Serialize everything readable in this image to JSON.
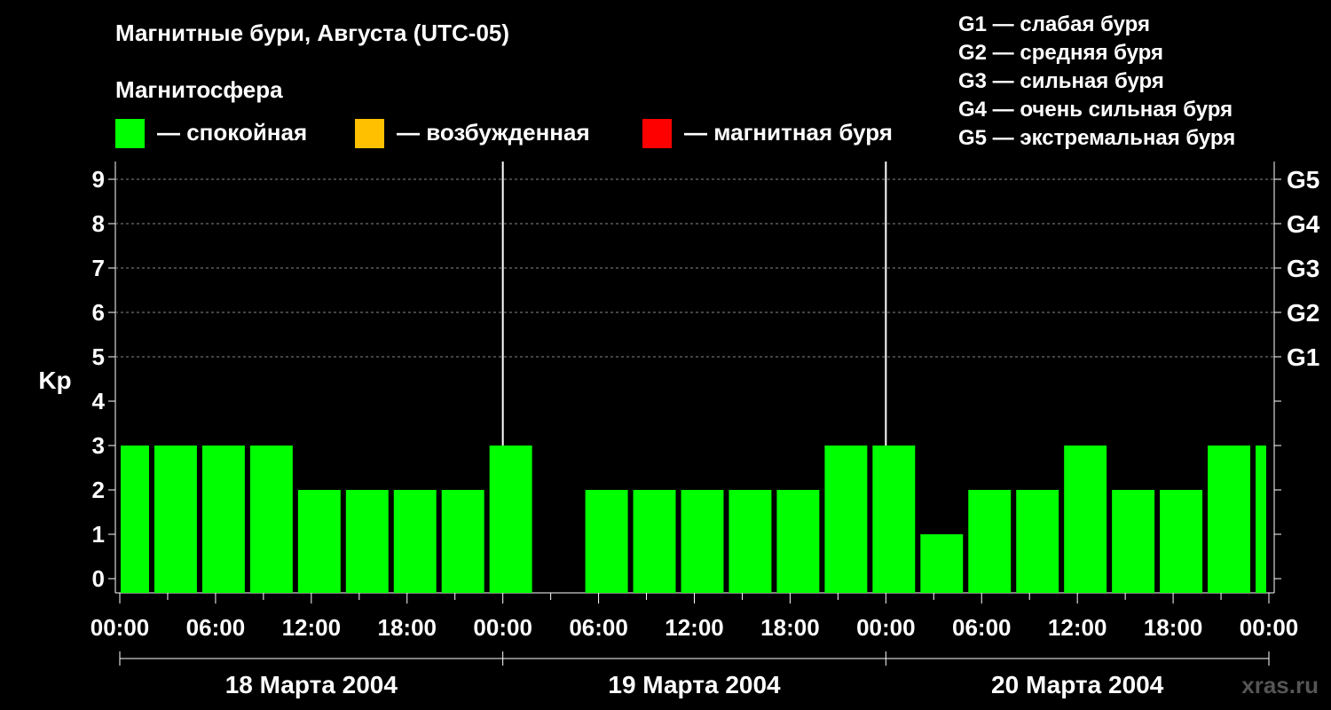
{
  "header": {
    "title": "Магнитные бури, Августа (UTC-05)",
    "subtitle": "Магнитосфера"
  },
  "legend": {
    "items": [
      {
        "label": "— спокойная",
        "color": "#00ff00"
      },
      {
        "label": "— возбужденная",
        "color": "#ffc000"
      },
      {
        "label": "— магнитная буря",
        "color": "#ff0000"
      }
    ],
    "storm_levels": [
      "G1 — слабая буря",
      "G2 — средняя буря",
      "G3 — сильная буря",
      "G4 — очень сильная буря",
      "G5 — экстремальная буря"
    ]
  },
  "watermark": "xras.ru",
  "chart_data": {
    "type": "bar",
    "ylabel": "Kp",
    "ylim": [
      0,
      9
    ],
    "yticks": [
      0,
      1,
      2,
      3,
      4,
      5,
      6,
      7,
      8,
      9
    ],
    "right_axis_labels": [
      {
        "kp": 5,
        "label": "G1"
      },
      {
        "kp": 6,
        "label": "G2"
      },
      {
        "kp": 7,
        "label": "G3"
      },
      {
        "kp": 8,
        "label": "G4"
      },
      {
        "kp": 9,
        "label": "G5"
      }
    ],
    "grid": "horizontal dashed at Kp 5-9",
    "x_tick_labels": [
      "00:00",
      "06:00",
      "12:00",
      "18:00",
      "00:00",
      "06:00",
      "12:00",
      "18:00",
      "00:00",
      "06:00",
      "12:00",
      "18:00",
      "00:00"
    ],
    "day_labels": [
      "18 Марта 2004",
      "19 Марта 2004",
      "20 Марта 2004"
    ],
    "series": [
      {
        "color": "#00ff00",
        "values": [
          3,
          3,
          3,
          3,
          2,
          2,
          2,
          2,
          3,
          0,
          2,
          2,
          2,
          2,
          2,
          3,
          3,
          1,
          2,
          2,
          3,
          2,
          2,
          3,
          3
        ]
      }
    ],
    "bar_interval_hours": 3,
    "first_bar_partial": true,
    "colors": {
      "quiet": "#00ff00",
      "active": "#ffc000",
      "storm": "#ff0000",
      "axis": "#ffffff",
      "grid": "#888888"
    }
  }
}
